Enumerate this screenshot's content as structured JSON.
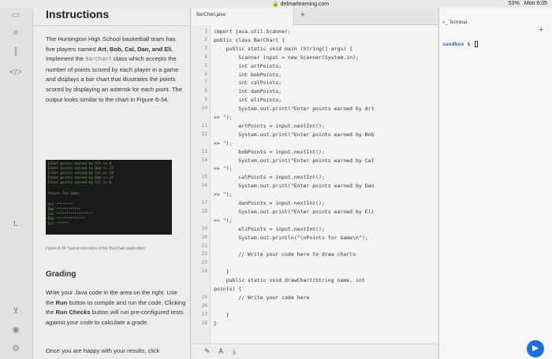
{
  "statusbar": {
    "url": "🔒 delmarlearning.com",
    "battery": "53%",
    "clock": "Mon 6:05"
  },
  "instructions": {
    "title": "Instructions",
    "para1_a": "The Huntington High School basketball team has five players named ",
    "para1_names": "Art, Bob, Cal, Dan, and Eli",
    "para1_b": ". Implement the ",
    "para1_code": "BarChart",
    "para1_c": " class which accepts the number of points scored by each player in a game and displays a bar chart that illustrates the points scored by displaying an asterisk for each point. The output looks similar to the chart in Figure 6-34.",
    "figure_lines": [
      "Enter points earned by Art >> 8",
      "Enter points earned by Bob >> 12",
      "Enter points earned by Cal >> 18",
      "Enter points earned by Dan >> 14",
      "Enter points earned by Eli >> 6",
      "",
      "Points for Game",
      "",
      "Art  ********",
      "Bob  ************",
      "Cal  ******************",
      "Dan  **************",
      "Eli  ******"
    ],
    "figure_caption": "Figure 6-34   Typical execution of the BarChart application",
    "grading_title": "Grading",
    "grading_a": "Write your Java code in the area on the right. Use the ",
    "grading_run": "Run",
    "grading_b": " button to compile and run the code. Clicking the ",
    "grading_checks": "Run Checks",
    "grading_c": " button will run pre-configured tests against your code to calculate a grade.",
    "footer_text": "Once you are happy with your results, click"
  },
  "editor": {
    "tab_label": "BarChart.java",
    "add_tab": "+",
    "lines": [
      {
        "n": "1",
        "code": "import java.util.Scanner;"
      },
      {
        "n": "2",
        "code": "public class BarChart {"
      },
      {
        "n": "3",
        "code": "    public static void main (String[] args) {"
      },
      {
        "n": "4",
        "code": "        Scanner input = new Scanner(System.in);"
      },
      {
        "n": "5",
        "code": "        int artPoints;"
      },
      {
        "n": "6",
        "code": "        int bobPoints;"
      },
      {
        "n": "7",
        "code": "        int calPoints;"
      },
      {
        "n": "8",
        "code": "        int danPoints;"
      },
      {
        "n": "9",
        "code": "        int eliPoints;"
      },
      {
        "n": "10",
        "code": "        System.out.print(\"Enter points earned by Art"
      },
      {
        "n": "",
        "code": ">> \");"
      },
      {
        "n": "11",
        "code": "        artPoints = input.nextInt();"
      },
      {
        "n": "12",
        "code": "        System.out.print(\"Enter points earned by Bob"
      },
      {
        "n": "",
        "code": ">> \");"
      },
      {
        "n": "13",
        "code": "        bobPoints = input.nextInt();"
      },
      {
        "n": "14",
        "code": "        System.out.print(\"Enter points earned by Cal"
      },
      {
        "n": "",
        "code": ">> \");"
      },
      {
        "n": "15",
        "code": "        calPoints = input.nextInt();"
      },
      {
        "n": "16",
        "code": "        System.out.print(\"Enter points earned by Dan"
      },
      {
        "n": "",
        "code": ">> \");"
      },
      {
        "n": "17",
        "code": "        danPoints = input.nextInt();"
      },
      {
        "n": "18",
        "code": "        System.out.print(\"Enter points earned by Eli"
      },
      {
        "n": "",
        "code": ">> \");"
      },
      {
        "n": "19",
        "code": "        eliPoints = input.nextInt();"
      },
      {
        "n": "20",
        "code": "        System.out.println(\"\\nPoints for Game\\n\");"
      },
      {
        "n": "21",
        "code": ""
      },
      {
        "n": "22",
        "code": "        // Write your code here to draw charts"
      },
      {
        "n": "23",
        "code": ""
      },
      {
        "n": "24",
        "code": "    }"
      },
      {
        "n": "",
        "code": "    public static void drawChart(String name, int"
      },
      {
        "n": "",
        "code": "points) {"
      },
      {
        "n": "25",
        "code": "        // Write your code here"
      },
      {
        "n": "26",
        "code": ""
      },
      {
        "n": "27",
        "code": "    }"
      },
      {
        "n": "28",
        "code": "}"
      }
    ]
  },
  "terminal": {
    "tab_label": ">_ Terminal",
    "add_tab": "+",
    "prompt_user": "sandbox",
    "prompt_symbol": "$"
  },
  "colors": {
    "accent": "#1e6fd9",
    "code_word": "#6a8aa0",
    "prompt_user": "#2e6db4"
  }
}
